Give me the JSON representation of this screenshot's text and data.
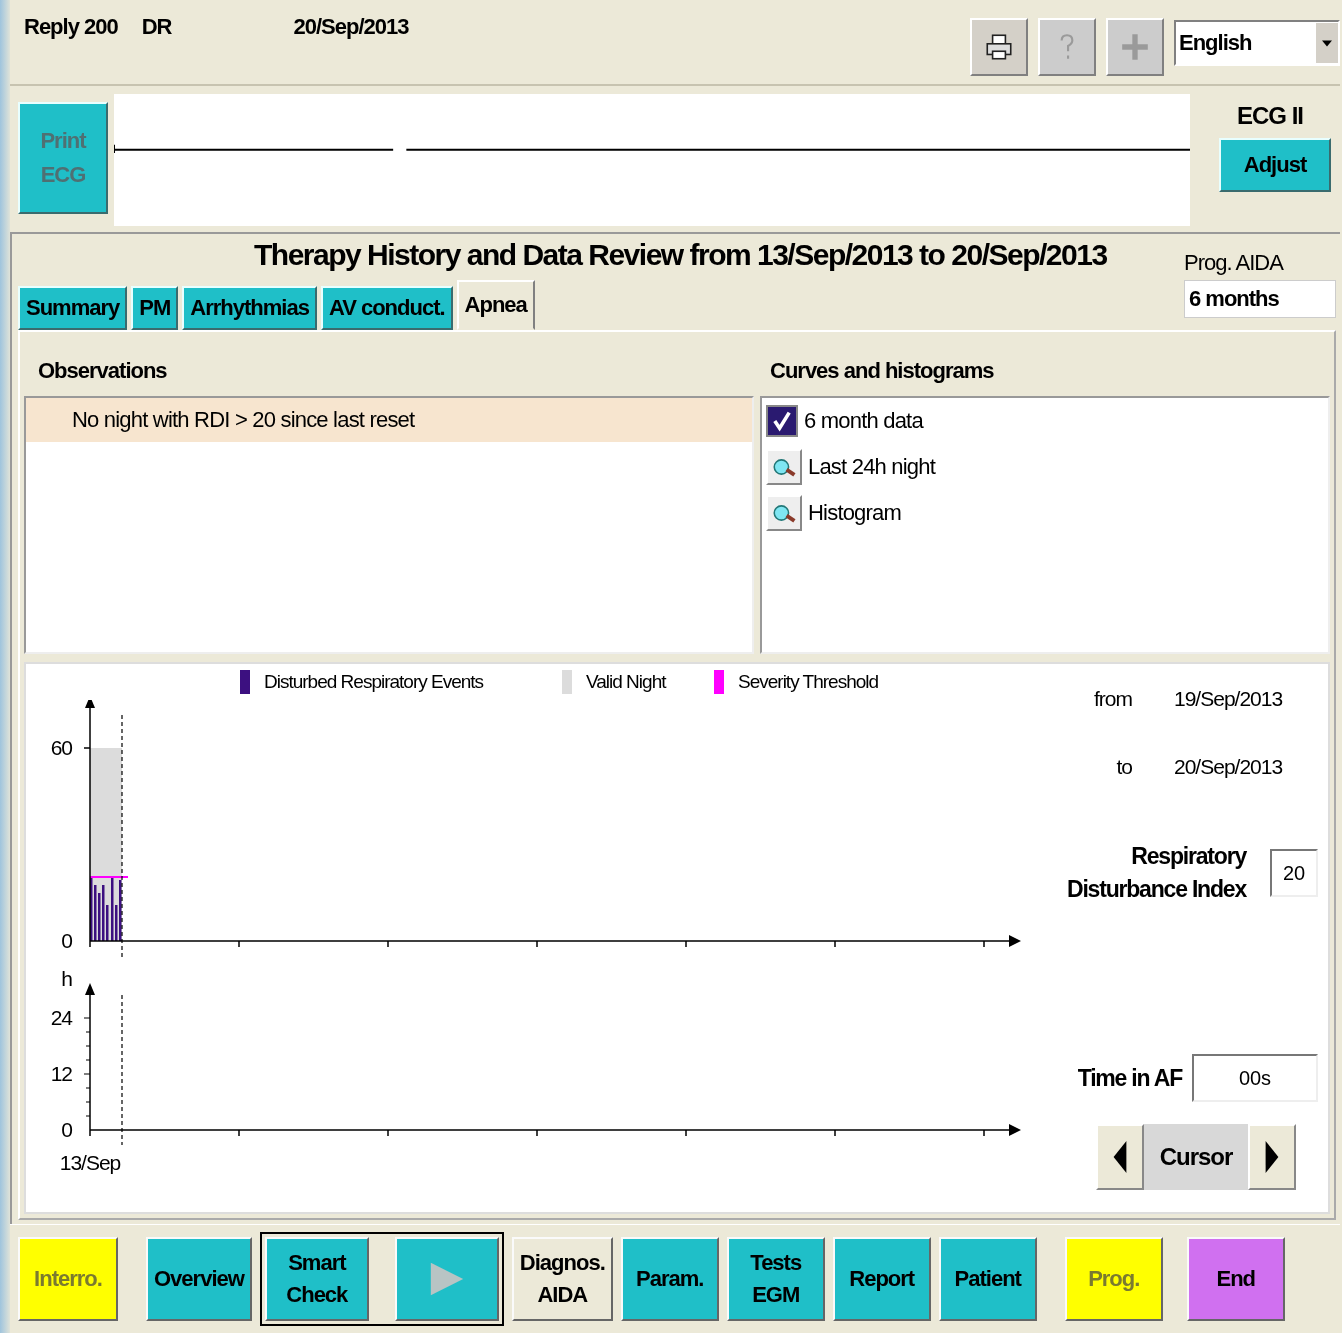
{
  "header": {
    "texts": [
      "Reply 200",
      "DR",
      "20/Sep/2013"
    ],
    "tools": [
      {
        "kind": "print",
        "disabled": false
      },
      {
        "kind": "help",
        "disabled": true
      },
      {
        "kind": "plus",
        "disabled": true
      }
    ],
    "language": "English"
  },
  "ecg": {
    "print_button": {
      "label": "Print ECG",
      "disabled": true
    },
    "lead": "ECG II",
    "adjust": "Adjust"
  },
  "title": "Therapy History and Data Review from 13/Sep/2013 to 20/Sep/2013",
  "tabs": [
    {
      "label": "Summary",
      "selected": false
    },
    {
      "label": "PM",
      "selected": false
    },
    {
      "label": "Arrhythmias",
      "selected": false
    },
    {
      "label": "AV conduct.",
      "selected": false
    },
    {
      "label": "Apnea",
      "selected": true
    }
  ],
  "prog": {
    "label": "Prog. AIDA",
    "value": "6 months"
  },
  "observations": {
    "heading": "Observations",
    "items": [
      {
        "text": "No night with RDI > 20 since last reset",
        "selected": true
      }
    ]
  },
  "curves": {
    "heading": "Curves and histograms",
    "items": [
      {
        "kind": "checkbox",
        "label": "6 month data",
        "checked": true
      },
      {
        "kind": "view",
        "label": "Last 24h night"
      },
      {
        "kind": "view",
        "label": "Histogram"
      }
    ]
  },
  "legend": [
    {
      "label": "Disturbed Respiratory Events",
      "color": "#3c1080"
    },
    {
      "label": "Valid Night",
      "color": "#dcdcdc"
    },
    {
      "label": "Severity Threshold",
      "color": "#ff00ff"
    }
  ],
  "rdi_chart": {
    "ytick_labels": [
      "60",
      "0"
    ]
  },
  "af_chart": {
    "unit": "h",
    "ytick_labels": [
      "24",
      "12",
      "0"
    ],
    "xtick_label": "13/Sep"
  },
  "side": {
    "from_label": "from",
    "from": "19/Sep/2013",
    "to_label": "to",
    "to": "20/Sep/2013",
    "rdi_label": "Respiratory Disturbance Index",
    "rdi": "20",
    "af_label": "Time in AF",
    "af": "00s",
    "cursor": "Cursor"
  },
  "bottom_buttons": [
    {
      "kind": "plain",
      "label": "Interro.",
      "color": "#ffff00",
      "disabled": true
    },
    {
      "kind": "plain",
      "label": "Overview",
      "color": "#1fbfc8",
      "disabled": false
    },
    {
      "kind": "framed",
      "label": "Smart Check",
      "color": "#1fbfc8",
      "disabled": false
    },
    {
      "kind": "play",
      "color": "#1fbfc8"
    },
    {
      "kind": "plain",
      "label": "Diagnos. AIDA",
      "color": "#ece9d8",
      "disabled": false
    },
    {
      "kind": "plain",
      "label": "Param.",
      "color": "#1fbfc8",
      "disabled": false
    },
    {
      "kind": "plain",
      "label": "Tests EGM",
      "color": "#1fbfc8",
      "disabled": false
    },
    {
      "kind": "plain",
      "label": "Report",
      "color": "#1fbfc8",
      "disabled": false
    },
    {
      "kind": "plain",
      "label": "Patient",
      "color": "#1fbfc8",
      "disabled": false
    },
    {
      "kind": "plain",
      "label": "Prog.",
      "color": "#ffff00",
      "disabled": true
    },
    {
      "kind": "plain",
      "label": "End",
      "color": "#d070f0",
      "disabled": false
    }
  ]
}
